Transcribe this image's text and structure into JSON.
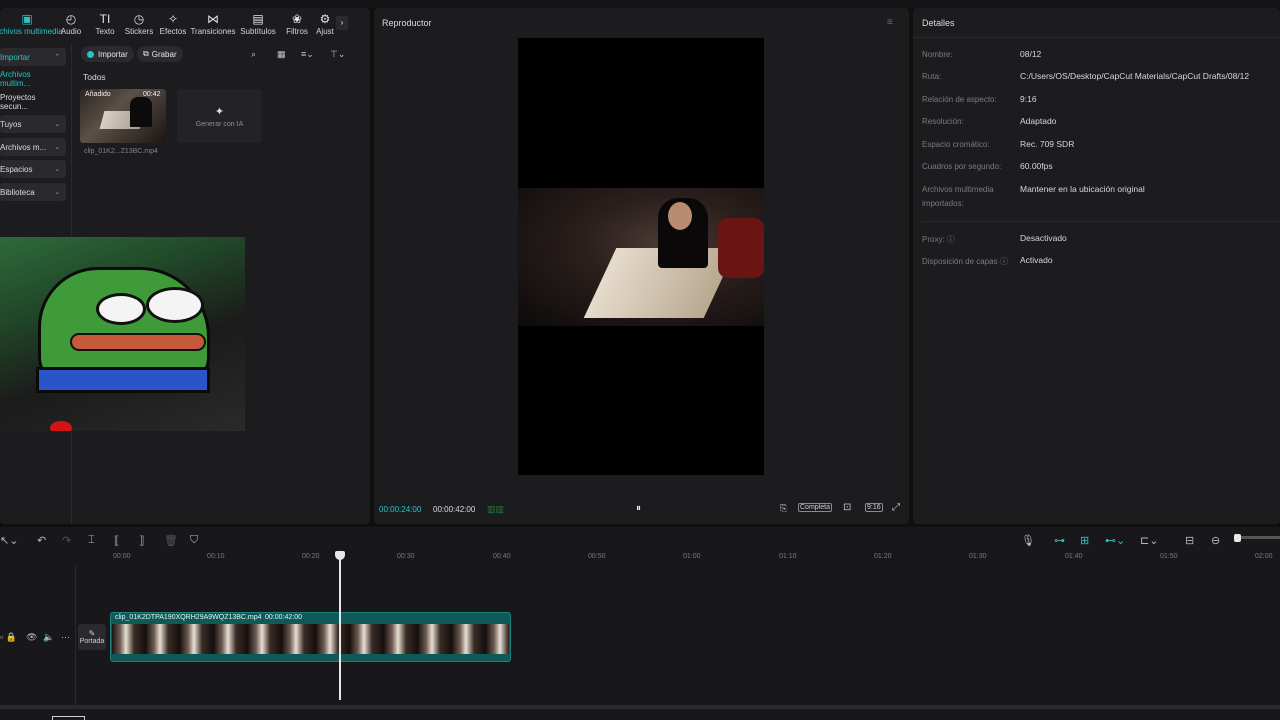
{
  "toolbar": {
    "tabs": [
      {
        "label": "Archivos multimedia",
        "icon": "media-icon",
        "active": true
      },
      {
        "label": "Audio",
        "icon": "audio-icon"
      },
      {
        "label": "Texto",
        "icon": "text-icon"
      },
      {
        "label": "Stickers",
        "icon": "sticker-icon"
      },
      {
        "label": "Efectos",
        "icon": "effects-icon"
      },
      {
        "label": "Transiciones",
        "icon": "transitions-icon"
      },
      {
        "label": "Subtítulos",
        "icon": "subtitles-icon"
      },
      {
        "label": "Filtros",
        "icon": "filters-icon"
      },
      {
        "label": "Ajust",
        "icon": "adjust-icon"
      }
    ]
  },
  "sidebar": {
    "items": [
      {
        "label": "Importar",
        "caret": "^"
      },
      {
        "label": "Archivos multim..."
      },
      {
        "label": "Proyectos secun..."
      },
      {
        "label": "Tuyos",
        "caret": "v"
      },
      {
        "label": "Archivos m...",
        "caret": "v"
      },
      {
        "label": "Espacios",
        "caret": "v"
      },
      {
        "label": "Biblioteca",
        "caret": "v"
      }
    ]
  },
  "media": {
    "import_label": "Importar",
    "record_label": "Grabar",
    "filter_label": "Todos",
    "clip": {
      "badge": "Añadido",
      "duration": "00:42",
      "name": "clip_01K2...Z13BC.mp4"
    },
    "generate_label": "Generar con IA"
  },
  "player": {
    "title": "Reproductor",
    "current_time": "00:00:24:00",
    "total_time": "00:00:42:00",
    "full_label": "Completa",
    "ratio_label": "9:16"
  },
  "details": {
    "title": "Detalles",
    "rows": [
      {
        "label": "Nombre:",
        "value": "08/12"
      },
      {
        "label": "Ruta:",
        "value": "C:/Users/OS/Desktop/CapCut Materials/CapCut Drafts/08/12"
      },
      {
        "label": "Relación de aspecto:",
        "value": "9:16"
      },
      {
        "label": "Resolución:",
        "value": "Adaptado"
      },
      {
        "label": "Espacio cromático:",
        "value": "Rec. 709 SDR"
      },
      {
        "label": "Cuadros por segundo:",
        "value": "60.00fps"
      },
      {
        "label": "Archivos multimedia",
        "value": "Mantener en la ubicación original"
      },
      {
        "label": "importados:",
        "value": ""
      },
      {
        "label": "Proxy:",
        "value": "Desactivado"
      },
      {
        "label": "Disposición de capas",
        "value": "Activado"
      }
    ]
  },
  "timeline": {
    "ticks": [
      "00:00",
      "00:10",
      "00:20",
      "00:30",
      "00:40",
      "00:50",
      "01:00",
      "01:10",
      "01:20",
      "01:30",
      "01:40",
      "01:50",
      "02:00"
    ],
    "clip_label": "clip_01K2DTPA190XQRH29A9WQZ13BC.mp4",
    "clip_duration": "00:00:42:00",
    "cover_label": "Portada"
  },
  "colors": {
    "accent": "#27c4c6",
    "panel": "#1c1c1f",
    "clip": "#0f5a58"
  }
}
